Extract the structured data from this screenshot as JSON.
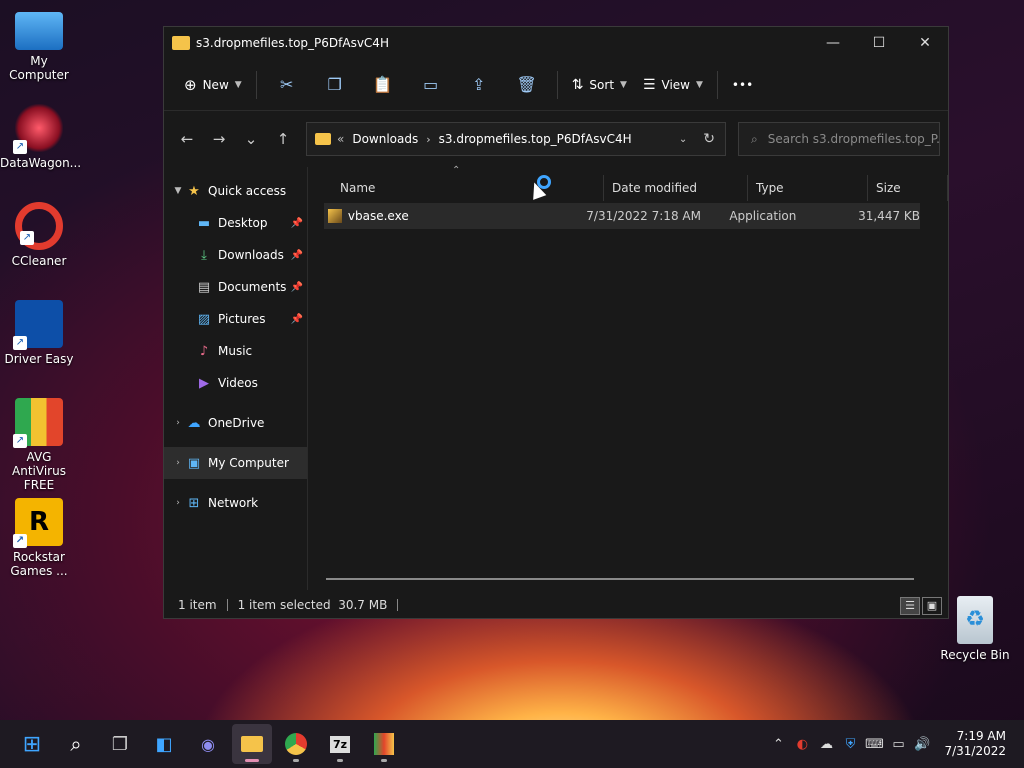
{
  "desktop": {
    "icons": [
      {
        "label": "My Computer",
        "icon": "computer-icon"
      },
      {
        "label": "DataWagon...",
        "icon": "datawagon-icon"
      },
      {
        "label": "CCleaner",
        "icon": "ccleaner-icon"
      },
      {
        "label": "Driver Easy",
        "icon": "driver-easy-icon"
      },
      {
        "label": "AVG AntiVirus FREE",
        "icon": "avg-icon"
      },
      {
        "label": "Rockstar Games ...",
        "icon": "rockstar-icon"
      },
      {
        "label": "Recycle Bin",
        "icon": "recycle-bin-icon"
      }
    ]
  },
  "window": {
    "title": "s3.dropmefiles.top_P6DfAsvC4H",
    "controls": {
      "minimize": "—",
      "maximize": "☐",
      "close": "✕"
    }
  },
  "toolbar": {
    "new_label": "New",
    "sort_label": "Sort",
    "view_label": "View",
    "more_label": "•••"
  },
  "nav": {
    "back": "←",
    "forward": "→",
    "recent": "⌄",
    "up": "↑",
    "breadcrumb_prefix": "«",
    "breadcrumb": [
      "Downloads",
      "s3.dropmefiles.top_P6DfAsvC4H"
    ],
    "search_placeholder": "Search s3.dropmefiles.top_P..."
  },
  "sidebar": {
    "quick_access": "Quick access",
    "items": [
      {
        "label": "Desktop",
        "pinned": true
      },
      {
        "label": "Downloads",
        "pinned": true
      },
      {
        "label": "Documents",
        "pinned": true
      },
      {
        "label": "Pictures",
        "pinned": true
      },
      {
        "label": "Music",
        "pinned": false
      },
      {
        "label": "Videos",
        "pinned": false
      }
    ],
    "onedrive": "OneDrive",
    "my_computer": "My Computer",
    "network": "Network"
  },
  "file_list": {
    "columns": [
      "Name",
      "Date modified",
      "Type",
      "Size"
    ],
    "rows": [
      {
        "name": "vbase.exe",
        "date": "7/31/2022 7:18 AM",
        "type": "Application",
        "size": "31,447 KB"
      }
    ]
  },
  "status": {
    "count": "1 item",
    "selected": "1 item selected  30.7 MB"
  },
  "taskbar": {
    "time": "7:19 AM",
    "date": "7/31/2022"
  }
}
